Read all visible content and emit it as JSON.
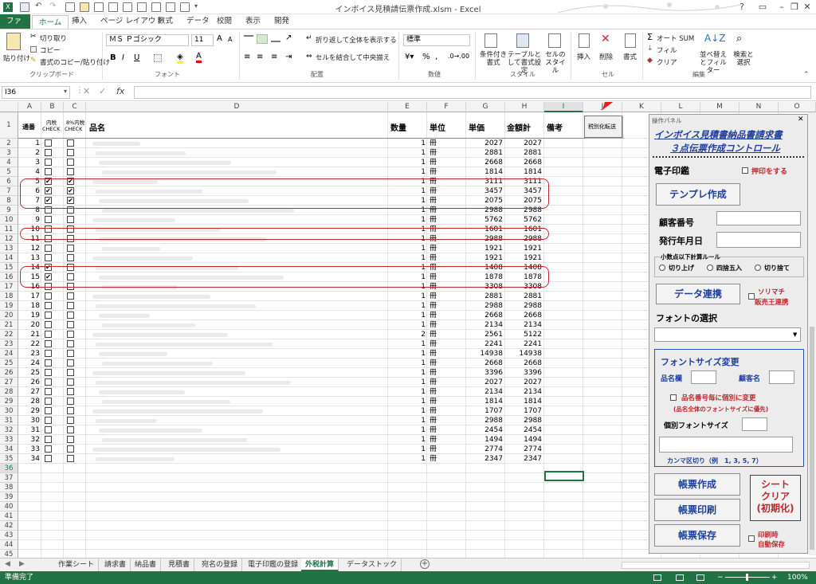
{
  "window": {
    "title": "インボイス見積請伝票作成.xlsm - Excel"
  },
  "tabs": [
    "ファイル",
    "ホーム",
    "挿入",
    "ページ レイアウト",
    "数式",
    "データ",
    "校閲",
    "表示",
    "開発"
  ],
  "ribbon": {
    "clipboard": {
      "paste": "貼り付け",
      "cut": "切り取り",
      "copy": "コピー",
      "format_painter": "書式のコピー/貼り付け",
      "label": "クリップボード"
    },
    "font": {
      "name": "ＭＳ Ｐゴシック",
      "size": "11",
      "bold": "B",
      "italic": "I",
      "underline": "U",
      "label": "フォント"
    },
    "align": {
      "wrap": "折り返して全体を表示する",
      "merge": "セルを結合して中央揃え",
      "label": "配置"
    },
    "number": {
      "format": "標準",
      "label": "数値"
    },
    "styles": {
      "cond": "条件付き書式",
      "table": "テーブルとして書式設定",
      "cell": "セルのスタイル",
      "label": "スタイル"
    },
    "cells": {
      "insert": "挿入",
      "delete": "削除",
      "format": "書式",
      "label": "セル"
    },
    "editing": {
      "autosum": "オート SUM",
      "fill": "フィル",
      "clear": "クリア",
      "sort": "並べ替えとフィルター",
      "find": "検索と選択",
      "label": "編集"
    }
  },
  "formula": {
    "namebox": "I36",
    "fx": "fx"
  },
  "columns": [
    "A",
    "B",
    "C",
    "D",
    "E",
    "F",
    "G",
    "H",
    "I",
    "J",
    "K",
    "L",
    "M",
    "N",
    "O"
  ],
  "headers": {
    "a": "通番",
    "b_top": "内税",
    "b_bot": "CHECK",
    "c_top": "8%内税",
    "c_bot": "CHECK",
    "d": "品名",
    "e": "数量",
    "f": "単位",
    "g": "単価",
    "h": "金額計",
    "i": "備考",
    "j": "税別化転送"
  },
  "rows": [
    {
      "n": "1",
      "b": false,
      "c": false,
      "qty": "1",
      "unit": "冊",
      "price": "2027",
      "total": "2027"
    },
    {
      "n": "2",
      "b": false,
      "c": false,
      "qty": "1",
      "unit": "冊",
      "price": "2881",
      "total": "2881"
    },
    {
      "n": "3",
      "b": false,
      "c": false,
      "qty": "1",
      "unit": "冊",
      "price": "2668",
      "total": "2668"
    },
    {
      "n": "4",
      "b": false,
      "c": false,
      "qty": "1",
      "unit": "冊",
      "price": "1814",
      "total": "1814"
    },
    {
      "n": "5",
      "b": true,
      "c": true,
      "qty": "1",
      "unit": "冊",
      "price": "3111",
      "total": "3111"
    },
    {
      "n": "6",
      "b": true,
      "c": true,
      "qty": "1",
      "unit": "冊",
      "price": "3457",
      "total": "3457"
    },
    {
      "n": "7",
      "b": true,
      "c": true,
      "qty": "1",
      "unit": "冊",
      "price": "2075",
      "total": "2075"
    },
    {
      "n": "8",
      "b": false,
      "c": false,
      "qty": "1",
      "unit": "冊",
      "price": "2988",
      "total": "2988"
    },
    {
      "n": "9",
      "b": false,
      "c": false,
      "qty": "1",
      "unit": "冊",
      "price": "5762",
      "total": "5762"
    },
    {
      "n": "10",
      "b": false,
      "c": false,
      "qty": "1",
      "unit": "冊",
      "price": "1601",
      "total": "1601"
    },
    {
      "n": "11",
      "b": false,
      "c": false,
      "qty": "1",
      "unit": "冊",
      "price": "2988",
      "total": "2988"
    },
    {
      "n": "12",
      "b": false,
      "c": false,
      "qty": "1",
      "unit": "冊",
      "price": "1921",
      "total": "1921"
    },
    {
      "n": "13",
      "b": false,
      "c": false,
      "qty": "1",
      "unit": "冊",
      "price": "1921",
      "total": "1921"
    },
    {
      "n": "14",
      "b": true,
      "c": false,
      "qty": "1",
      "unit": "冊",
      "price": "1408",
      "total": "1408"
    },
    {
      "n": "15",
      "b": true,
      "c": false,
      "qty": "1",
      "unit": "冊",
      "price": "1878",
      "total": "1878"
    },
    {
      "n": "16",
      "b": false,
      "c": false,
      "qty": "1",
      "unit": "冊",
      "price": "3308",
      "total": "3308"
    },
    {
      "n": "17",
      "b": false,
      "c": false,
      "qty": "1",
      "unit": "冊",
      "price": "2881",
      "total": "2881"
    },
    {
      "n": "18",
      "b": false,
      "c": false,
      "qty": "1",
      "unit": "冊",
      "price": "2988",
      "total": "2988"
    },
    {
      "n": "19",
      "b": false,
      "c": false,
      "qty": "1",
      "unit": "冊",
      "price": "2668",
      "total": "2668"
    },
    {
      "n": "20",
      "b": false,
      "c": false,
      "qty": "1",
      "unit": "冊",
      "price": "2134",
      "total": "2134"
    },
    {
      "n": "21",
      "b": false,
      "c": false,
      "qty": "2",
      "unit": "冊",
      "price": "2561",
      "total": "5122"
    },
    {
      "n": "22",
      "b": false,
      "c": false,
      "qty": "1",
      "unit": "冊",
      "price": "2241",
      "total": "2241"
    },
    {
      "n": "23",
      "b": false,
      "c": false,
      "qty": "1",
      "unit": "冊",
      "price": "14938",
      "total": "14938"
    },
    {
      "n": "24",
      "b": false,
      "c": false,
      "qty": "1",
      "unit": "冊",
      "price": "2668",
      "total": "2668"
    },
    {
      "n": "25",
      "b": false,
      "c": false,
      "qty": "1",
      "unit": "冊",
      "price": "3396",
      "total": "3396"
    },
    {
      "n": "26",
      "b": false,
      "c": false,
      "qty": "1",
      "unit": "冊",
      "price": "2027",
      "total": "2027"
    },
    {
      "n": "27",
      "b": false,
      "c": false,
      "qty": "1",
      "unit": "冊",
      "price": "2134",
      "total": "2134"
    },
    {
      "n": "28",
      "b": false,
      "c": false,
      "qty": "1",
      "unit": "冊",
      "price": "1814",
      "total": "1814"
    },
    {
      "n": "29",
      "b": false,
      "c": false,
      "qty": "1",
      "unit": "冊",
      "price": "1707",
      "total": "1707"
    },
    {
      "n": "30",
      "b": false,
      "c": false,
      "qty": "1",
      "unit": "冊",
      "price": "2988",
      "total": "2988"
    },
    {
      "n": "31",
      "b": false,
      "c": false,
      "qty": "1",
      "unit": "冊",
      "price": "2454",
      "total": "2454"
    },
    {
      "n": "32",
      "b": false,
      "c": false,
      "qty": "1",
      "unit": "冊",
      "price": "1494",
      "total": "1494"
    },
    {
      "n": "33",
      "b": false,
      "c": false,
      "qty": "1",
      "unit": "冊",
      "price": "2774",
      "total": "2774"
    },
    {
      "n": "34",
      "b": false,
      "c": false,
      "qty": "1",
      "unit": "冊",
      "price": "2347",
      "total": "2347"
    }
  ],
  "panel": {
    "caption": "操作パネル",
    "title1": "インボイス見積書納品書請求書",
    "title2": "３点伝票作成コントロール",
    "stamp_label": "電子印鑑",
    "stamp_check": "押印をする",
    "template_btn": "テンプレ作成",
    "customer_no": "顧客番号",
    "issue_date": "発行年月日",
    "rounding_label": "小数点以下計算ルール",
    "round_up": "切り上げ",
    "round_half": "四捨五入",
    "round_down": "切り捨て",
    "data_link_btn": "データ連携",
    "solimachi": "ソリマチ",
    "solimachi2": "販売王連携",
    "font_select": "フォントの選択",
    "fontsize_title": "フォントサイズ変更",
    "item_col": "品名欄",
    "customer_name": "顧客名",
    "indiv_check": "品名番号毎に個別に変更",
    "indiv_note": "(品名全体のフォントサイズに優先)",
    "indiv_size": "個別フォントサイズ",
    "comma_note": "カンマ区切り（例　1, 3, 5, 7）",
    "create_btn": "帳票作成",
    "print_btn": "帳票印刷",
    "save_btn": "帳票保存",
    "clear1": "シート",
    "clear2": "クリア",
    "clear3": "(初期化)",
    "auto1": "印刷時",
    "auto2": "自動保存"
  },
  "sheets": [
    "作業シート",
    "請求書",
    "納品書",
    "見積書",
    "宛名の登録",
    "電子印鑑の登録",
    "外税計算",
    "データストック"
  ],
  "active_sheet": "外税計算",
  "status": {
    "ready": "準備完了",
    "zoom": "100%"
  }
}
